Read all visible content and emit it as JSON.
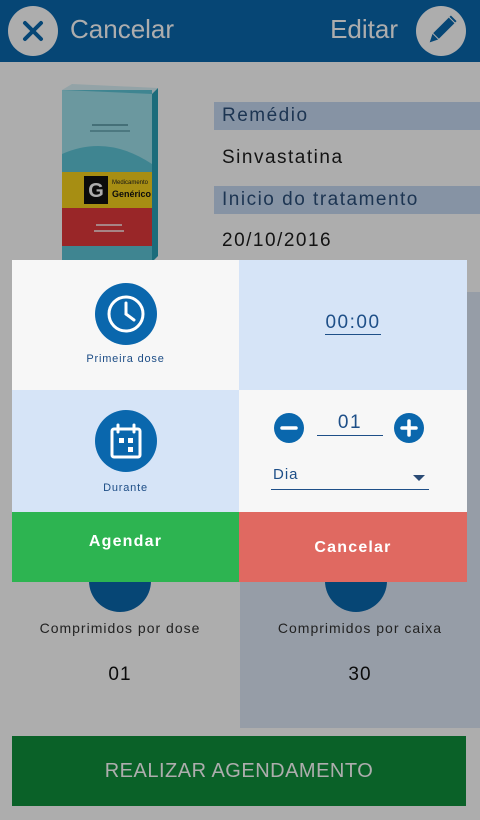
{
  "header": {
    "cancel_label": "Cancelar",
    "edit_label": "Editar"
  },
  "medicine": {
    "name_label": "Remédio",
    "name_value": "Sinvastatina",
    "start_label": "Inicio do tratamento",
    "start_value": "20/10/2016",
    "box_logo_letter": "G",
    "box_brand_line1": "Medicamento",
    "box_brand_line2": "Genérico"
  },
  "stats": {
    "per_dose_label": "Comprimidos por dose",
    "per_dose_value": "01",
    "per_box_label": "Comprimidos por caixa",
    "per_box_value": "30"
  },
  "footer": {
    "action_label": "REALIZAR AGENDAMENTO"
  },
  "dialog": {
    "first_dose_label": "Primeira dose",
    "time_value": "00:00",
    "duration_label": "Durante",
    "duration_value": "01",
    "duration_unit": "Dia",
    "schedule_button": "Agendar",
    "cancel_button": "Cancelar"
  },
  "colors": {
    "primary_blue": "#0a67ad",
    "light_blue": "#d6e4f7",
    "confirm_green": "#2db451",
    "cancel_red": "#e06961",
    "footer_green": "#0f8f3c"
  },
  "icons": {
    "cancel": "close-icon",
    "edit": "pencil-icon",
    "first_dose": "clock-icon",
    "duration": "calendar-icon",
    "decrement": "minus-icon",
    "increment": "plus-icon",
    "per_dose": "pill-icon",
    "per_box": "pill-box-icon"
  }
}
